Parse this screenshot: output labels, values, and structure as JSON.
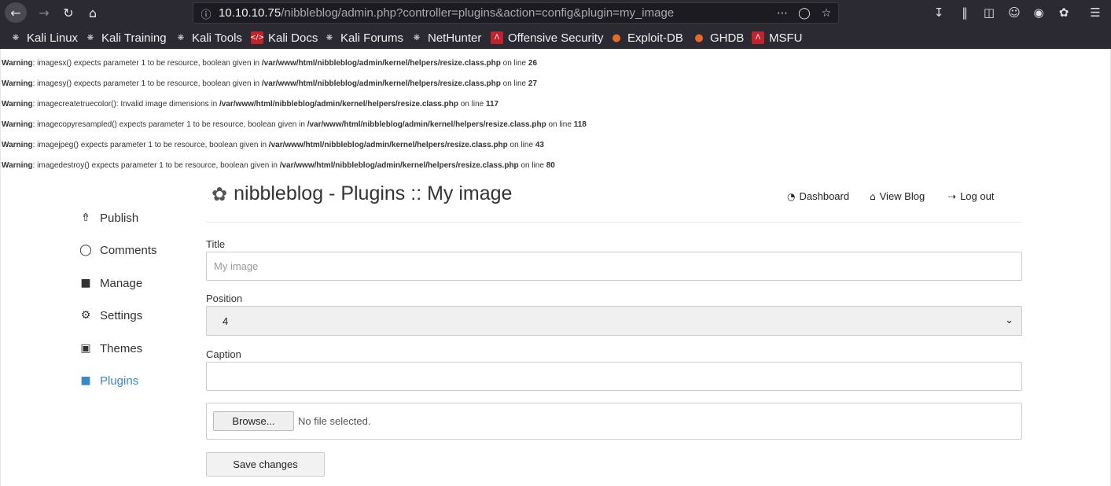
{
  "browser": {
    "url_host": "10.10.10.75",
    "url_path": "/nibbleblog/admin.php?controller=plugins&action=config&plugin=my_image",
    "icons": [
      "back-icon",
      "forward-icon",
      "reload-icon",
      "home-icon",
      "info-icon",
      "more-icon",
      "pocket-icon",
      "star-icon",
      "download-icon",
      "library-icon",
      "sidebar-icon",
      "account-icon",
      "extension-icon",
      "addon-icon",
      "menu-icon"
    ]
  },
  "bookmarks": [
    {
      "label": "Kali Linux",
      "icon": "kali-dragon"
    },
    {
      "label": "Kali Training",
      "icon": "kali-dragon"
    },
    {
      "label": "Kali Tools",
      "icon": "kali-dragon"
    },
    {
      "label": "Kali Docs",
      "icon": "kali-docs"
    },
    {
      "label": "Kali Forums",
      "icon": "kali-dragon"
    },
    {
      "label": "NetHunter",
      "icon": "kali-dragon"
    },
    {
      "label": "Offensive Security",
      "icon": "offsec"
    },
    {
      "label": "Exploit-DB",
      "icon": "exploitdb"
    },
    {
      "label": "GHDB",
      "icon": "exploitdb"
    },
    {
      "label": "MSFU",
      "icon": "offsec"
    }
  ],
  "warnings": [
    {
      "label": "Warning",
      "msg": ": imagesx() expects parameter 1 to be resource, boolean given in ",
      "file": "/var/www/html/nibbleblog/admin/kernel/helpers/resize.class.php",
      "on": " on line ",
      "line": "26"
    },
    {
      "label": "Warning",
      "msg": ": imagesy() expects parameter 1 to be resource, boolean given in ",
      "file": "/var/www/html/nibbleblog/admin/kernel/helpers/resize.class.php",
      "on": " on line ",
      "line": "27"
    },
    {
      "label": "Warning",
      "msg": ": imagecreatetruecolor(): Invalid image dimensions in ",
      "file": "/var/www/html/nibbleblog/admin/kernel/helpers/resize.class.php",
      "on": " on line ",
      "line": "117"
    },
    {
      "label": "Warning",
      "msg": ": imagecopyresampled() expects parameter 1 to be resource, boolean given in ",
      "file": "/var/www/html/nibbleblog/admin/kernel/helpers/resize.class.php",
      "on": " on line ",
      "line": "118"
    },
    {
      "label": "Warning",
      "msg": ": imagejpeg() expects parameter 1 to be resource, boolean given in ",
      "file": "/var/www/html/nibbleblog/admin/kernel/helpers/resize.class.php",
      "on": " on line ",
      "line": "43"
    },
    {
      "label": "Warning",
      "msg": ": imagedestroy() expects parameter 1 to be resource, boolean given in ",
      "file": "/var/www/html/nibbleblog/admin/kernel/helpers/resize.class.php",
      "on": " on line ",
      "line": "80"
    }
  ],
  "sidebar": {
    "items": [
      {
        "label": "Publish",
        "icon": "publish-icon"
      },
      {
        "label": "Comments",
        "icon": "comment-icon"
      },
      {
        "label": "Manage",
        "icon": "folder-icon"
      },
      {
        "label": "Settings",
        "icon": "gear-icon"
      },
      {
        "label": "Themes",
        "icon": "image-icon"
      },
      {
        "label": "Plugins",
        "icon": "folder-open-icon",
        "active": true
      }
    ]
  },
  "header": {
    "title": "nibbleblog - Plugins :: My image",
    "nav": [
      {
        "label": "Dashboard",
        "icon": "dashboard-icon"
      },
      {
        "label": "View Blog",
        "icon": "home-icon"
      },
      {
        "label": "Log out",
        "icon": "logout-icon"
      }
    ]
  },
  "form": {
    "title_label": "Title",
    "title_value": "My image",
    "position_label": "Position",
    "position_value": "4",
    "caption_label": "Caption",
    "caption_value": "",
    "browse_label": "Browse...",
    "no_file": "No file selected.",
    "save_label": "Save changes"
  },
  "colors": {
    "chrome": "#2b2a33",
    "accent": "#3a87c8"
  }
}
